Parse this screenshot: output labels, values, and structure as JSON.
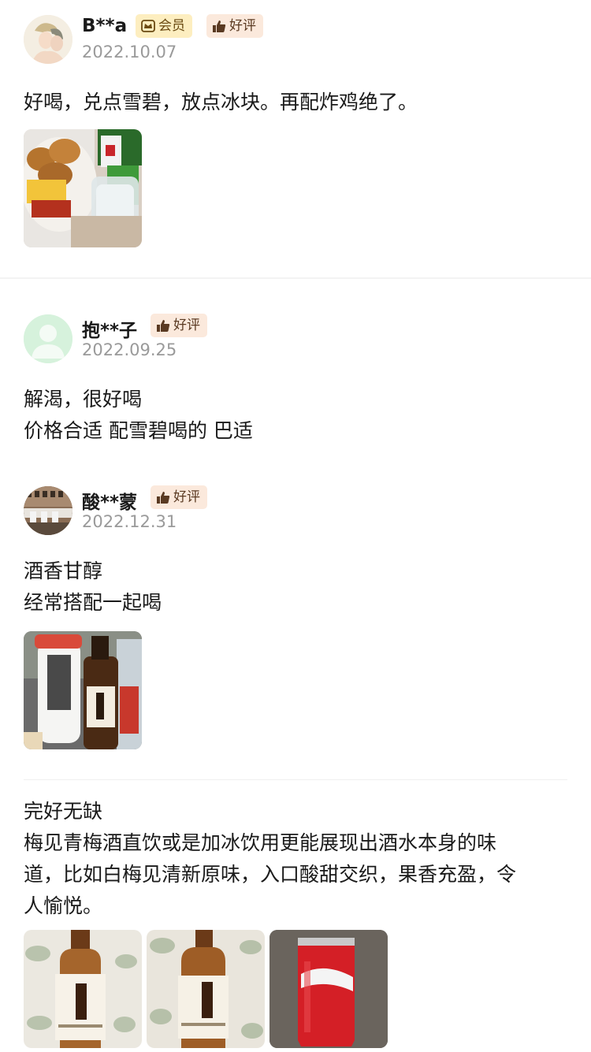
{
  "reviews": [
    {
      "username": "B**a",
      "member_badge": "会员",
      "rating_badge": "好评",
      "date": "2022.10.07",
      "lines": [
        "好喝，兑点雪碧，放点冰块。再配炸鸡绝了。"
      ],
      "photos": [
        "fried-chicken-and-drink"
      ]
    },
    {
      "username": "抱**子",
      "rating_badge": "好评",
      "date": "2022.09.25",
      "lines": [
        "解渴，很好喝",
        "价格合适 配雪碧喝的 巴适"
      ],
      "photos": []
    },
    {
      "username": "酸**蒙",
      "rating_badge": "好评",
      "date": "2022.12.31",
      "lines": [
        "酒香甘醇",
        "经常搭配一起喝"
      ],
      "photos": [
        "bottles-on-table"
      ]
    },
    {
      "lines": [
        "完好无缺",
        "梅见青梅酒直饮或是加冰饮用更能展现出酒水本身的味",
        "道，比如白梅见清新原味，入口酸甜交织，果香充盈，令",
        "人愉悦。"
      ],
      "photos": [
        "meijian-bottle",
        "meijian-bottle",
        "cola-can"
      ]
    }
  ],
  "icons": {
    "member": "crown-icon",
    "good": "thumbs-up-icon"
  },
  "colors": {
    "member_badge_bg": "#fdeec0",
    "good_badge_bg": "#fbe9dc",
    "date_gray": "#9a9a9a"
  }
}
